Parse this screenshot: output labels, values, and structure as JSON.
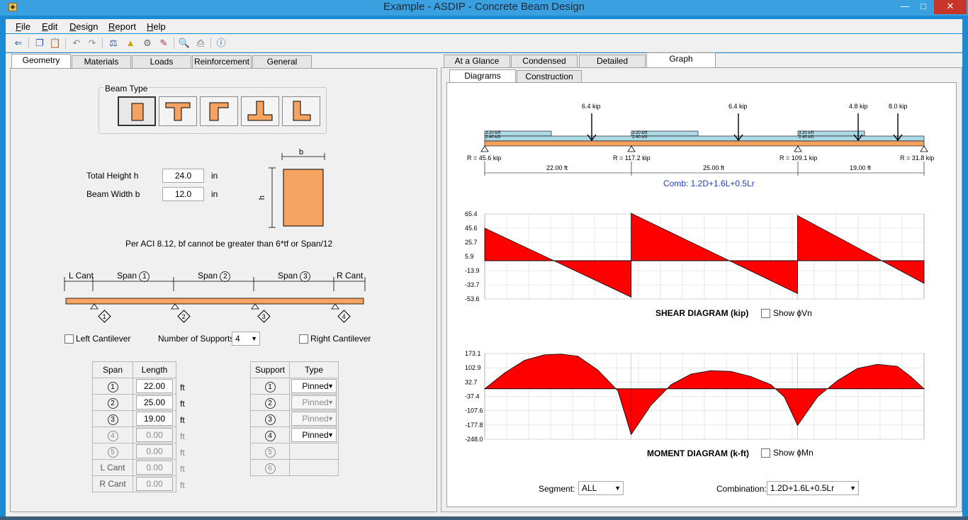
{
  "window": {
    "title": "Example - ASDIP - Concrete Beam Design",
    "app_icon": "app-logo-icon"
  },
  "menu": [
    "File",
    "Edit",
    "Design",
    "Report",
    "Help"
  ],
  "toolbar_icons": [
    "pm-arrow-icon",
    "copy-icon",
    "paste-icon",
    "undo-icon",
    "redo-icon",
    "units-icon",
    "triangle-warning-icon",
    "settings-gear-icon",
    "design-icon",
    "zoom-icon",
    "print-icon",
    "help-icon"
  ],
  "left_tabs": [
    "Geometry",
    "Materials",
    "Loads",
    "Reinforcement",
    "General"
  ],
  "beam_type": {
    "title": "Beam Type",
    "options": [
      "rectangular",
      "T-beam",
      "inverted-L",
      "inverted-T",
      "L-beam"
    ],
    "selected": 0
  },
  "geometry": {
    "height_label": "Total Height  h",
    "height_value": "24.0",
    "height_unit": "in",
    "width_label": "Beam Width  b",
    "width_value": "12.0",
    "width_unit": "in",
    "section_b": "b",
    "section_h": "h",
    "note": "Per ACI 8.12, bf cannot be greater than 6*tf or Span/12"
  },
  "span_diagram": {
    "l_cant": "L Cant",
    "r_cant": "R Cant",
    "span_label": "Span",
    "spans": [
      "1",
      "2",
      "3"
    ],
    "supports": [
      "1",
      "2",
      "3",
      "4"
    ]
  },
  "options": {
    "left_cantilever": "Left Cantilever",
    "num_supports_label": "Number of Supports:",
    "num_supports": "4",
    "right_cantilever": "Right Cantilever"
  },
  "span_table": {
    "headers": [
      "Span",
      "Length"
    ],
    "unit": "ft",
    "rows": [
      {
        "id": "1",
        "value": "22.00",
        "enabled": true
      },
      {
        "id": "2",
        "value": "25.00",
        "enabled": true
      },
      {
        "id": "3",
        "value": "19.00",
        "enabled": true
      },
      {
        "id": "4",
        "value": "0.00",
        "enabled": false
      },
      {
        "id": "5",
        "value": "0.00",
        "enabled": false
      },
      {
        "id": "L Cant",
        "value": "0.00",
        "enabled": false
      },
      {
        "id": "R Cant",
        "value": "0.00",
        "enabled": false
      }
    ]
  },
  "support_table": {
    "headers": [
      "Support",
      "Type"
    ],
    "rows": [
      {
        "id": "1",
        "type": "Pinned",
        "enabled": true
      },
      {
        "id": "2",
        "type": "Pinned",
        "enabled": false
      },
      {
        "id": "3",
        "type": "Pinned",
        "enabled": false
      },
      {
        "id": "4",
        "type": "Pinned",
        "enabled": true
      },
      {
        "id": "5",
        "type": "",
        "enabled": false
      },
      {
        "id": "6",
        "type": "",
        "enabled": false
      }
    ]
  },
  "right_tabs": [
    "At a Glance",
    "Condensed",
    "Detailed",
    "Graph"
  ],
  "right_tab_active": 3,
  "subtabs": [
    "Diagrams",
    "Construction"
  ],
  "subtab_active": 0,
  "loading": {
    "point_loads": [
      "6.4 kip",
      "6.4 kip",
      "4.8 kip",
      "8.0 kip"
    ],
    "dist_labels": [
      "3.20 k/ft",
      "2.40 k/ft"
    ],
    "reactions": [
      "R = 45.6 kip",
      "R = 117.2 kip",
      "R = 109.1 kip",
      "R = 31.8 kip"
    ],
    "span_dims": [
      "22.00 ft",
      "25.00 ft",
      "19.00 ft"
    ],
    "combination": "Comb: 1.2D+1.6L+0.5Lr"
  },
  "shear": {
    "title": "SHEAR DIAGRAM (kip)",
    "show_label": "Show ϕVn",
    "ticks": [
      "65.4",
      "45.6",
      "25.7",
      "5.9",
      "-13.9",
      "-33.7",
      "-53.6"
    ]
  },
  "moment": {
    "title": "MOMENT DIAGRAM (k-ft)",
    "show_label": "Show ϕMn",
    "ticks": [
      "173.1",
      "102.9",
      "32.7",
      "-37.4",
      "-107.6",
      "-177.8",
      "-248.0"
    ]
  },
  "bottom": {
    "segment_label": "Segment:",
    "segment_value": "ALL",
    "combination_label": "Combination:",
    "combination_value": "1.2D+1.6L+0.5Lr"
  },
  "colors": {
    "beam": "#f4a460",
    "diagram_fill": "#ff0000",
    "dist_load": "#add8e6",
    "link": "#1f3fbf"
  },
  "chart_data": [
    {
      "type": "area",
      "title": "SHEAR DIAGRAM (kip)",
      "x": [
        0,
        22,
        47,
        66
      ],
      "ytick_labels": [
        "65.4",
        "45.6",
        "25.7",
        "5.9",
        "-13.9",
        "-33.7",
        "-53.6"
      ],
      "ylim": [
        -53.6,
        65.4
      ],
      "series": [
        {
          "x": [
            0,
            0,
            22,
            22,
            47,
            47,
            66,
            66
          ],
          "y": [
            0,
            45.6,
            -51.0,
            66.2,
            -46.0,
            63.1,
            -31.8,
            0
          ]
        }
      ],
      "grid": true
    },
    {
      "type": "area",
      "title": "MOMENT DIAGRAM (k-ft)",
      "x": [
        0,
        22,
        47,
        66
      ],
      "ytick_labels": [
        "173.1",
        "102.9",
        "32.7",
        "-37.4",
        "-107.6",
        "-177.8",
        "-248.0"
      ],
      "ylim": [
        -248.0,
        173.1
      ],
      "series": [
        {
          "x": [
            0,
            3,
            6,
            9,
            11.5,
            14,
            17,
            20,
            22,
            25,
            28,
            31,
            34,
            37,
            40,
            43,
            45,
            47,
            50,
            53,
            56,
            59,
            62,
            64,
            66
          ],
          "y": [
            0,
            78,
            140,
            167,
            170,
            160,
            92,
            -10,
            -225,
            -80,
            20,
            72,
            89,
            85,
            60,
            20,
            -40,
            -180,
            -40,
            40,
            100,
            120,
            110,
            60,
            0
          ]
        }
      ],
      "grid": true
    }
  ]
}
